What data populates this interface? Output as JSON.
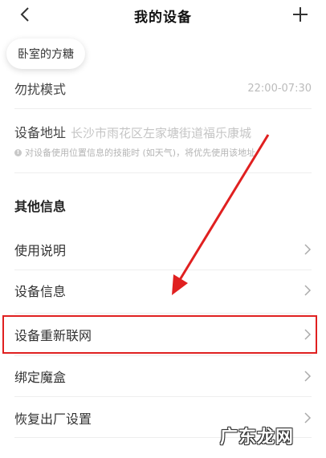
{
  "header": {
    "title": "我的设备"
  },
  "device_chip": {
    "label": "卧室的方糖"
  },
  "dnd": {
    "label": "勿扰模式",
    "value": "22:00-07:30"
  },
  "address": {
    "label": "设备地址",
    "value": "长沙市雨花区左家塘街道福乐康城",
    "note": "对设备使用位置信息的技能时 (如天气)，将优先使用该地址"
  },
  "other_info": {
    "section_title": "其他信息",
    "items": [
      {
        "label": "使用说明"
      },
      {
        "label": "设备信息"
      },
      {
        "label": "设备重新联网"
      },
      {
        "label": "绑定魔盒"
      },
      {
        "label": "恢复出厂设置"
      }
    ]
  },
  "annotation": {
    "color": "#e02020"
  },
  "watermark": {
    "text": "广东龙网"
  }
}
